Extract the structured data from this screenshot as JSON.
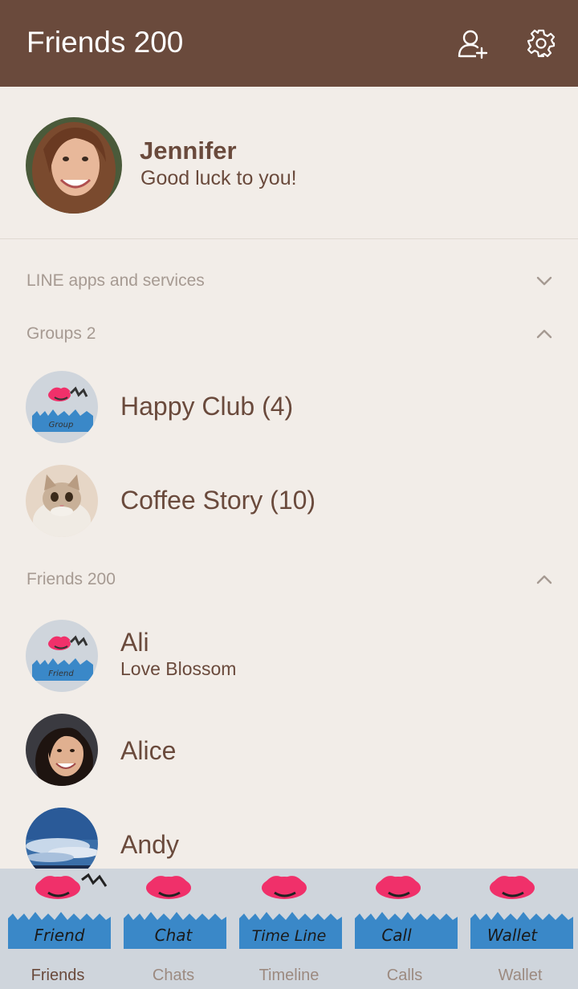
{
  "header": {
    "title": "Friends 200",
    "add_friend_icon": "add-friend-icon",
    "settings_icon": "gear-icon"
  },
  "profile": {
    "name": "Jennifer",
    "status": "Good luck to you!"
  },
  "sections": {
    "apps": {
      "label": "LINE apps and services",
      "state": "collapsed"
    },
    "groups": {
      "label": "Groups 2",
      "state": "expanded"
    },
    "friends": {
      "label": "Friends 200",
      "state": "expanded"
    }
  },
  "groups": [
    {
      "name": "Happy Club (4)",
      "avatar_text": "Group"
    },
    {
      "name": "Coffee Story (10)"
    }
  ],
  "friends": [
    {
      "name": "Ali",
      "status": "Love Blossom",
      "avatar_text": "Friend"
    },
    {
      "name": "Alice"
    },
    {
      "name": "Andy"
    }
  ],
  "tabs": [
    {
      "label": "Friends",
      "art_text": "Friend",
      "active": true
    },
    {
      "label": "Chats",
      "art_text": "Chat",
      "active": false
    },
    {
      "label": "Timeline",
      "art_text": "Time Line",
      "active": false
    },
    {
      "label": "Calls",
      "art_text": "Call",
      "active": false
    },
    {
      "label": "Wallet",
      "art_text": "Wallet",
      "active": false
    }
  ],
  "colors": {
    "header": "#6a4a3c",
    "background": "#f2ede8",
    "text": "#6a4a3c",
    "muted": "#a69a92",
    "tabbar": "#cfd5dc",
    "accent_pink": "#f0306a",
    "accent_blue": "#3a88c8"
  }
}
